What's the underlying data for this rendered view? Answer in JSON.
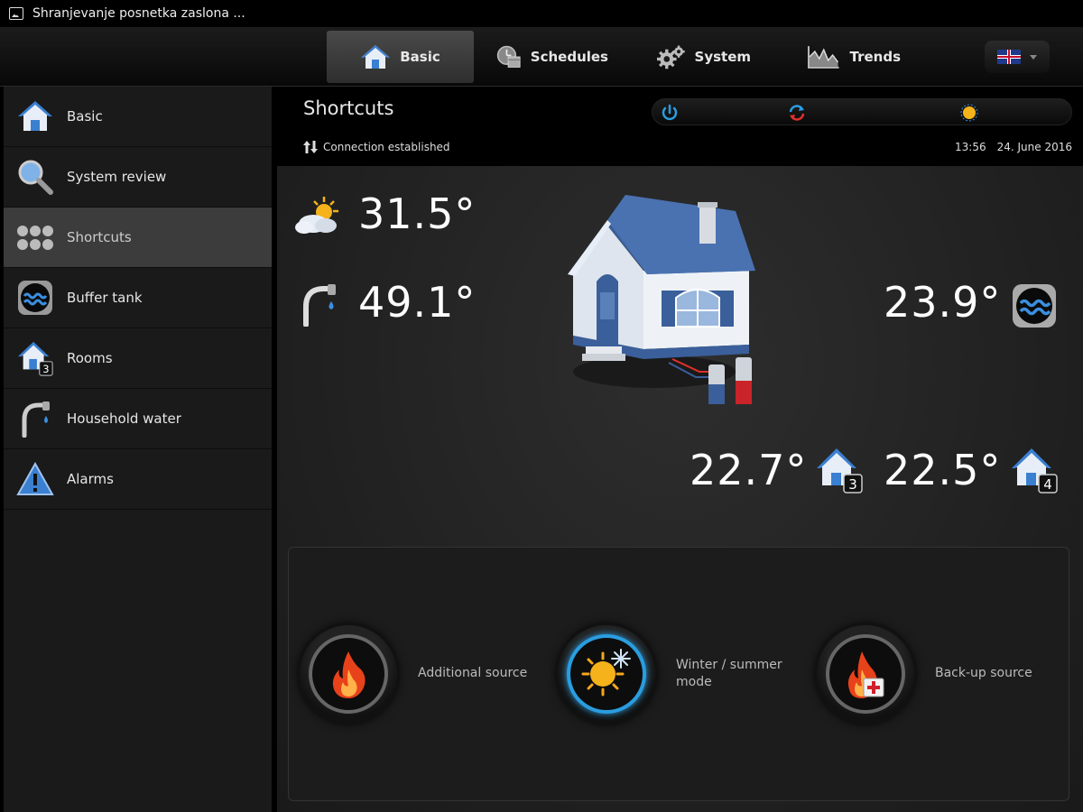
{
  "statusbar": {
    "title": "Shranjevanje posnetka zaslona ..."
  },
  "topnav": {
    "tabs": [
      {
        "label": "Basic",
        "icon": "house-icon",
        "active": true
      },
      {
        "label": "Schedules",
        "icon": "schedule-icon"
      },
      {
        "label": "System",
        "icon": "gears-icon"
      },
      {
        "label": "Trends",
        "icon": "trends-icon"
      }
    ],
    "language": "flag-uk-icon"
  },
  "sidebar": {
    "items": [
      {
        "label": "Basic",
        "icon": "house-icon"
      },
      {
        "label": "System review",
        "icon": "magnifier-icon"
      },
      {
        "label": "Shortcuts",
        "icon": "dots-grid-icon",
        "active": true
      },
      {
        "label": "Buffer tank",
        "icon": "water-waves-icon"
      },
      {
        "label": "Rooms",
        "icon": "house-badge-icon",
        "badge": "3"
      },
      {
        "label": "Household water",
        "icon": "faucet-icon"
      },
      {
        "label": "Alarms",
        "icon": "warning-icon"
      }
    ]
  },
  "header": {
    "title": "Shortcuts",
    "connection": "Connection established",
    "time": "13:56",
    "date": "24. June 2016"
  },
  "readings": {
    "outdoor": "31.5°",
    "household_water": "49.1°",
    "buffer_tank": "23.9°",
    "room3": "22.7°",
    "room3_badge": "3",
    "room4": "22.5°",
    "room4_badge": "4"
  },
  "shortcuts": {
    "additional_source": "Additional source",
    "winter_summer_line1": "Winter / summer",
    "winter_summer_line2": "mode",
    "backup_source": "Back-up source"
  },
  "colors": {
    "accent_blue": "#2a9de0",
    "house_blue": "#3a5f9a",
    "flame": "#e8421a"
  }
}
